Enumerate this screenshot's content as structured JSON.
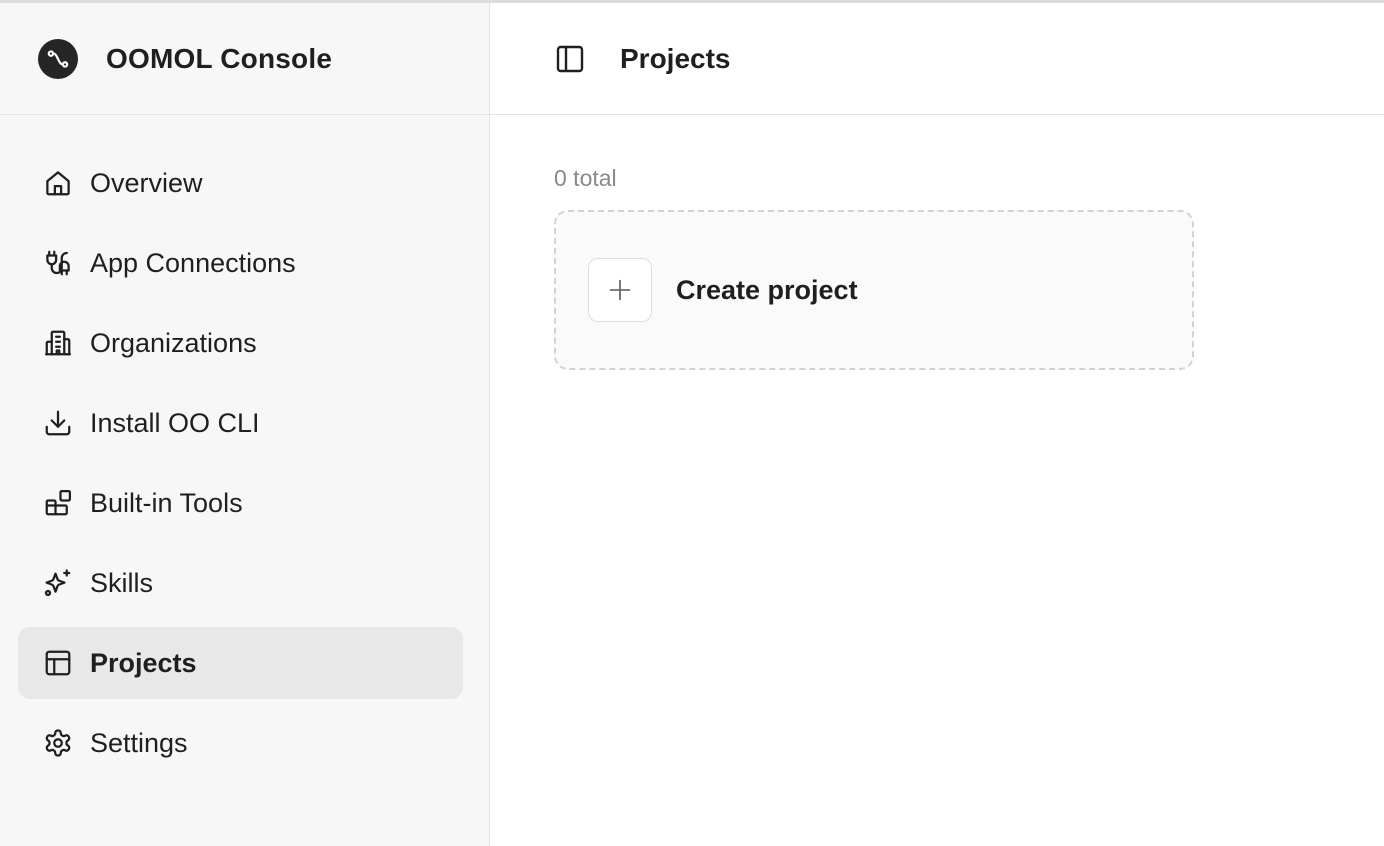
{
  "brand": {
    "title": "OOMOL Console",
    "logo_icon": "route-icon"
  },
  "sidebar": {
    "items": [
      {
        "label": "Overview",
        "icon": "home-icon",
        "active": false
      },
      {
        "label": "App Connections",
        "icon": "plug-icon",
        "active": false
      },
      {
        "label": "Organizations",
        "icon": "building-icon",
        "active": false
      },
      {
        "label": "Install OO CLI",
        "icon": "download-icon",
        "active": false
      },
      {
        "label": "Built-in Tools",
        "icon": "blocks-icon",
        "active": false
      },
      {
        "label": "Skills",
        "icon": "sparkles-icon",
        "active": false
      },
      {
        "label": "Projects",
        "icon": "layout-icon",
        "active": true
      },
      {
        "label": "Settings",
        "icon": "gear-icon",
        "active": false
      }
    ]
  },
  "header": {
    "toggle_icon": "sidebar-toggle-icon",
    "title": "Projects"
  },
  "main": {
    "count_text": "0 total",
    "create_card": {
      "label": "Create project",
      "icon": "plus-icon"
    }
  },
  "colors": {
    "sidebar_bg": "#f7f7f7",
    "active_item_bg": "#e8e8e8",
    "border": "#e4e4e4",
    "text": "#1f1f1f",
    "muted_text": "#8a8a8a",
    "logo_bg": "#262626"
  }
}
